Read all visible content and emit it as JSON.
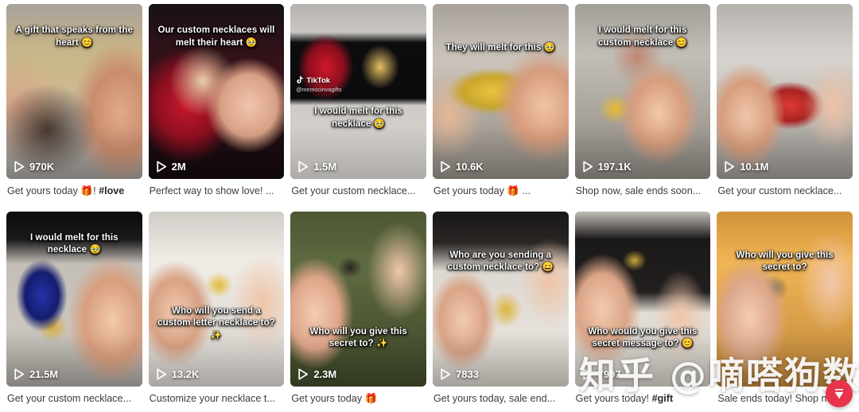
{
  "page": {
    "background": "#ffffff",
    "accent": "#e8334a",
    "caption_color": "#3c3c3c",
    "layout": "grid",
    "columns": 6,
    "rows": 2
  },
  "watermark": {
    "text": "知乎 @嘀嗒狗数据"
  },
  "back_to_top": {
    "icon": "back-to-top-icon",
    "color": "#e8334a"
  },
  "source_badge": {
    "platform": "TikTok",
    "username": "@memocinvagifts"
  },
  "cards": [
    {
      "id": 1,
      "overlay_text": "A gift that speaks from the heart 😊",
      "overlay_position": "top",
      "views": "970K",
      "caption": "Get yours today 🎁! ",
      "caption_bold": "#love",
      "play_icon": "play-triangle-icon",
      "thumb_class": "b1",
      "has_tiktok_mark": false
    },
    {
      "id": 2,
      "overlay_text": "Our custom necklaces will melt their heart 🥹",
      "overlay_position": "top",
      "views": "2M",
      "caption": "Perfect way to show love! ...",
      "caption_bold": "",
      "play_icon": "play-triangle-icon",
      "thumb_class": "b2",
      "has_tiktok_mark": false
    },
    {
      "id": 3,
      "overlay_text": "I would melt for this necklace 🥹",
      "overlay_position": "lower",
      "views": "1.5M",
      "caption": "Get your custom necklace...",
      "caption_bold": "",
      "play_icon": "play-triangle-icon",
      "thumb_class": "b3",
      "has_tiktok_mark": true
    },
    {
      "id": 4,
      "overlay_text": "They will melt for this 🥹",
      "overlay_position": "top-low",
      "views": "10.6K",
      "caption": "Get yours today 🎁 ...",
      "caption_bold": "",
      "play_icon": "play-triangle-icon",
      "thumb_class": "b4",
      "has_tiktok_mark": false
    },
    {
      "id": 5,
      "overlay_text": "I would melt for this custom necklace 😊",
      "overlay_position": "top",
      "views": "197.1K",
      "caption": "Shop now, sale ends soon...",
      "caption_bold": "",
      "play_icon": "play-triangle-icon",
      "thumb_class": "b5",
      "has_tiktok_mark": false
    },
    {
      "id": 6,
      "overlay_text": "",
      "overlay_position": "top",
      "views": "10.1M",
      "caption": "Get your custom necklace...",
      "caption_bold": "",
      "play_icon": "play-triangle-icon",
      "thumb_class": "b6",
      "has_tiktok_mark": false
    },
    {
      "id": 7,
      "overlay_text": "I would melt for this necklace 🥹",
      "overlay_position": "top",
      "views": "21.5M",
      "caption": "Get your custom necklace...",
      "caption_bold": "",
      "play_icon": "play-triangle-icon",
      "thumb_class": "b7",
      "has_tiktok_mark": false
    },
    {
      "id": 8,
      "overlay_text": "Who will you send a custom letter necklace to? ✨",
      "overlay_position": "mid-low",
      "views": "13.2K",
      "caption": "Customize your necklace t...",
      "caption_bold": "",
      "play_icon": "play-triangle-icon",
      "thumb_class": "b8",
      "has_tiktok_mark": false
    },
    {
      "id": 9,
      "overlay_text": "Who will you give this secret to? ✨",
      "overlay_position": "under",
      "views": "2.3M",
      "caption": "Get yours today 🎁",
      "caption_bold": "",
      "play_icon": "play-triangle-icon",
      "thumb_class": "b9",
      "has_tiktok_mark": false
    },
    {
      "id": 10,
      "overlay_text": "Who are you sending a custom necklace to? 😄",
      "overlay_position": "top-low",
      "views": "7833",
      "caption": "Get yours today, sale end...",
      "caption_bold": "",
      "play_icon": "play-triangle-icon",
      "thumb_class": "b10",
      "has_tiktok_mark": false
    },
    {
      "id": 11,
      "overlay_text": "Who would you give this secret message to? 😊",
      "overlay_position": "under",
      "views": "7997",
      "caption": "Get yours today! ",
      "caption_bold": "#gift",
      "play_icon": "play-triangle-icon",
      "thumb_class": "b11",
      "has_tiktok_mark": false
    },
    {
      "id": 12,
      "overlay_text": "Who will you give this secret to?",
      "overlay_position": "top-low",
      "views": "",
      "caption": "Sale ends today! Shop n...",
      "caption_bold": "",
      "play_icon": "play-triangle-icon",
      "thumb_class": "b12",
      "has_tiktok_mark": false
    }
  ]
}
